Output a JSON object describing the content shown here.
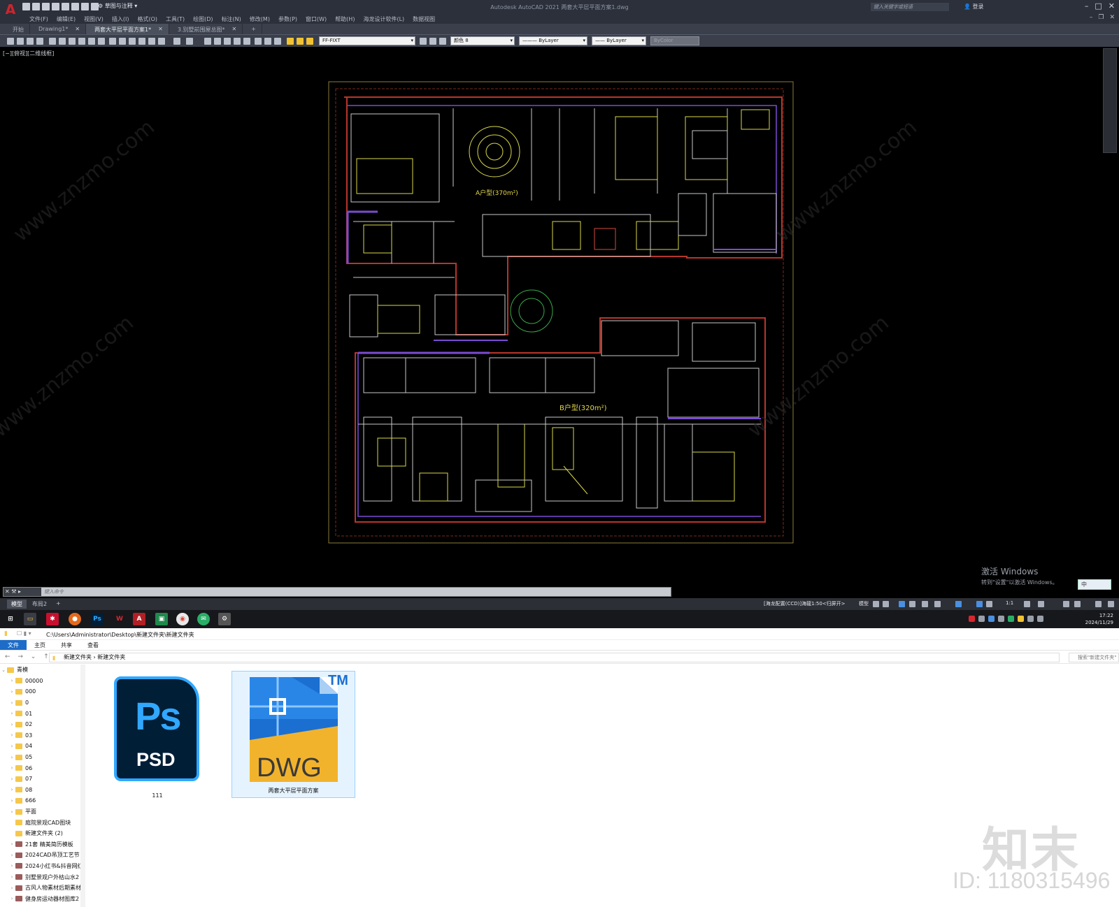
{
  "acad": {
    "title": "Autodesk AutoCAD 2021    两套大平层平面方案1.dwg",
    "workspace": "草图与注释",
    "search_placeholder": "键入关键字或短语",
    "login": "登录",
    "menus": [
      "文件(F)",
      "编辑(E)",
      "视图(V)",
      "插入(I)",
      "格式(O)",
      "工具(T)",
      "绘图(D)",
      "标注(N)",
      "修改(M)",
      "参数(P)",
      "窗口(W)",
      "帮助(H)",
      "海龙设计软件(L)",
      "数据视图"
    ],
    "tabs": [
      {
        "label": "开始"
      },
      {
        "label": "Drawing1*"
      },
      {
        "label": "两套大平层平面方案1*"
      },
      {
        "label": "3.别墅前围屋总图*"
      }
    ],
    "layer_combo": "FF-FIXT",
    "color_combo": "颜色 8",
    "linetype_combo": "ByLayer",
    "lineweight_combo": "ByLayer",
    "plotstyle_combo": "ByColor",
    "viewport_label": "[−][俯视][二维线框]",
    "cmd_placeholder": "键入命令",
    "layout_tabs": [
      "模型",
      "布局2"
    ],
    "status_text": "[海龙配置(CCD)]海龍1:50<归屏开>",
    "status_model": "模型",
    "scale": "1:1",
    "activate_line1": "激活 Windows",
    "activate_line2": "转到\"设置\"以激活 Windows。",
    "ime": "中",
    "plan_label_a": "A户型(370m²)",
    "plan_label_b": "B户型(320m²)",
    "watermark_url": "www.znzmo.com"
  },
  "taskbar": {
    "time": "17:22",
    "date": "2024/11/29",
    "apps": [
      "ps-icon",
      "wps-icon",
      "autocad-icon",
      "chrome-icon",
      "wechat-icon"
    ]
  },
  "explorer": {
    "title_path": "C:\\Users\\Administrator\\Desktop\\新建文件夹\\新建文件夹",
    "ribbon_tabs": [
      "文件",
      "主页",
      "共享",
      "查看"
    ],
    "breadcrumb": "新建文件夹  ›  新建文件夹",
    "search_placeholder": "搜索\"新建文件夹\"",
    "tree": [
      {
        "label": "青模",
        "type": "folder"
      },
      {
        "label": "00000",
        "type": "folder"
      },
      {
        "label": "000",
        "type": "folder"
      },
      {
        "label": "0",
        "type": "folder"
      },
      {
        "label": "01",
        "type": "folder"
      },
      {
        "label": "02",
        "type": "folder"
      },
      {
        "label": "03",
        "type": "folder"
      },
      {
        "label": "04",
        "type": "folder"
      },
      {
        "label": "05",
        "type": "folder"
      },
      {
        "label": "06",
        "type": "folder"
      },
      {
        "label": "07",
        "type": "folder"
      },
      {
        "label": "08",
        "type": "folder"
      },
      {
        "label": "666",
        "type": "folder"
      },
      {
        "label": "平面",
        "type": "folder"
      },
      {
        "label": "庭院景观CAD图块",
        "type": "folder"
      },
      {
        "label": "新建文件夹 (2)",
        "type": "folder"
      },
      {
        "label": "21套 精美简历模板",
        "type": "doc"
      },
      {
        "label": "2024CAD吊顶工艺节",
        "type": "doc"
      },
      {
        "label": "2024小红书&抖音网红",
        "type": "doc"
      },
      {
        "label": "别墅景观户外枯山水2",
        "type": "doc"
      },
      {
        "label": "古风人物素材后期素材",
        "type": "doc"
      },
      {
        "label": "健身房运动器材图库2",
        "type": "doc"
      }
    ],
    "files": [
      {
        "name": "111",
        "icon_title": "Ps",
        "icon_caption": "PSD"
      },
      {
        "name": "两套大平层平面方案",
        "icon_title": "TM",
        "icon_caption": "DWG"
      }
    ]
  },
  "watermark": {
    "logo": "知末",
    "id": "ID: 1180315496"
  }
}
